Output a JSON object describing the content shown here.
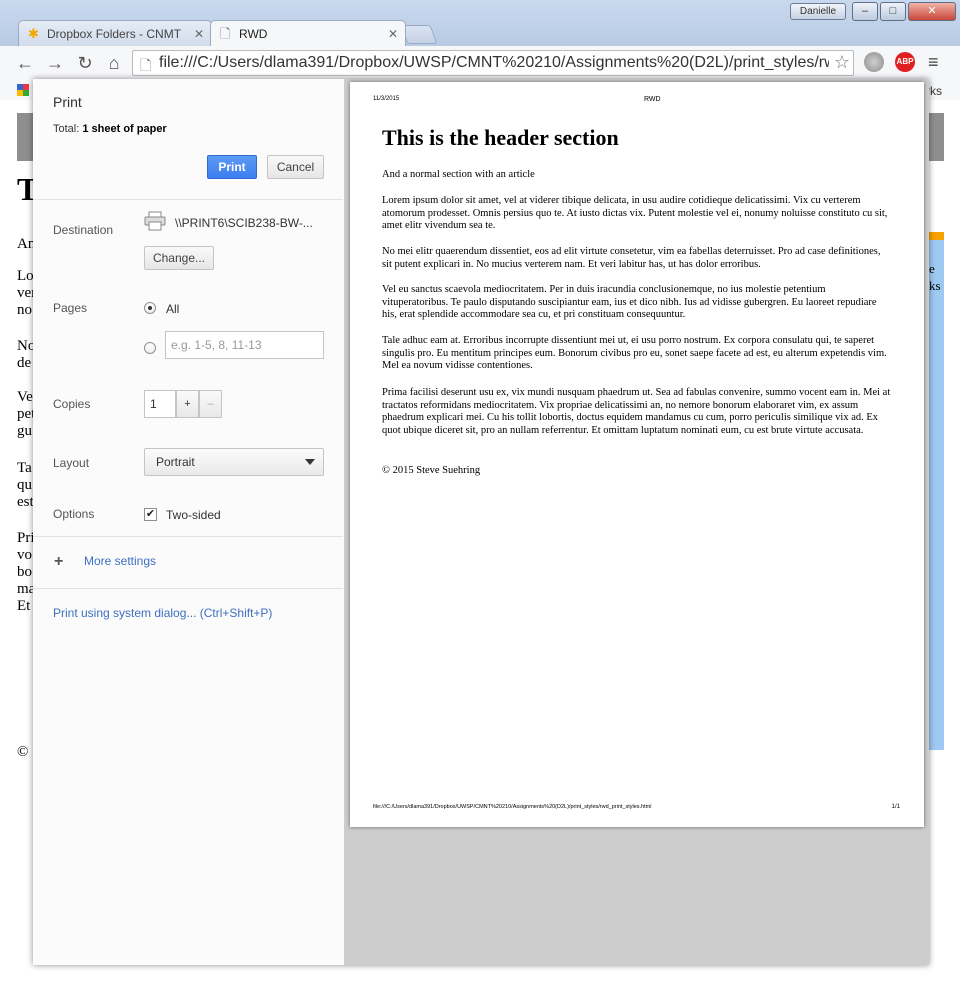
{
  "browser": {
    "user_name": "Danielle",
    "window_controls": {
      "minimize": "‒",
      "maximize": "□",
      "close": "✕"
    },
    "tabs": [
      {
        "title": "Dropbox Folders - CNMT",
        "icon": "dropbox-icon",
        "active": false
      },
      {
        "title": "RWD",
        "icon": "page-icon",
        "active": true
      }
    ],
    "address": "file:///C:/Users/dlama391/Dropbox/UWSP/CMNT%20210/Assignments%20(D2L)/print_styles/rw",
    "bookmarks_bar_right": "rks",
    "extensions": [
      {
        "name": "shield-extension-icon",
        "color": "#8a8a8a"
      },
      {
        "name": "adblock-plus-icon",
        "label": "ABP",
        "color": "#e02020"
      }
    ]
  },
  "background_page": {
    "heading_initial": "T",
    "lines": [
      "An",
      "Lo",
      "ver",
      "no",
      "No",
      "de",
      "Ve",
      "pet",
      "gu",
      "Ta",
      "qu",
      "est",
      "Pri",
      "vo",
      "bo",
      "ma",
      "Et",
      "©"
    ],
    "side_lines": [
      "e",
      "ks"
    ],
    "colors": {
      "header": "#8e8e8e",
      "sidebar": "#9ec9f3",
      "accent": "#f7a200"
    }
  },
  "print_dialog": {
    "title": "Print",
    "total_label": "Total:",
    "total_value": "1 sheet of paper",
    "print_button": "Print",
    "cancel_button": "Cancel",
    "destination": {
      "label": "Destination",
      "printer_name": "\\\\PRINT6\\SCIB238-BW-...",
      "change_button": "Change..."
    },
    "pages": {
      "label": "Pages",
      "all_label": "All",
      "all_selected": true,
      "range_placeholder": "e.g. 1-5, 8, 11-13"
    },
    "copies": {
      "label": "Copies",
      "value": "1",
      "increment": "+",
      "decrement": "–"
    },
    "layout": {
      "label": "Layout",
      "selected": "Portrait"
    },
    "options": {
      "label": "Options",
      "two_sided_label": "Two-sided",
      "two_sided_checked": true
    },
    "more_settings": "More settings",
    "system_dialog_link": "Print using system dialog... (Ctrl+Shift+P)",
    "accent_color": "#3b7ef0"
  },
  "preview": {
    "date": "11/3/2015",
    "page_title": "RWD",
    "header": "This is the header section",
    "paragraphs": [
      "And a normal section with an article",
      "Lorem ipsum dolor sit amet, vel at viderer tibique delicata, in usu audire cotidieque delicatissimi. Vix cu verterem atomorum prodesset. Omnis persius quo te. At iusto dictas vix. Putent molestie vel ei, nonumy noluisse constituto cu sit, amet elitr vivendum sea te.",
      "No mei elitr quaerendum dissentiet, eos ad elit virtute consetetur, vim ea fabellas deterruisset. Pro ad case definitiones, sit putent explicari in. No mucius verterem nam. Et veri labitur has, ut has dolor erroribus.",
      "Vel eu sanctus scaevola mediocritatem. Per in duis iracundia conclusionemque, no ius molestie petentium vituperatoribus. Te paulo disputando suscipiantur eam, ius et dico nibh. Ius ad vidisse gubergren. Eu laoreet repudiare his, erat splendide accommodare sea cu, et pri constituam consequuntur.",
      "Tale adhuc eam at. Erroribus incorrupte dissentiunt mei ut, ei usu porro nostrum. Ex corpora consulatu qui, te saperet singulis pro. Eu mentitum principes eum. Bonorum civibus pro eu, sonet saepe facete ad est, eu alterum expetendis vim. Mel ea novum vidisse contentiones.",
      "Prima facilisi deserunt usu ex, vix mundi nusquam phaedrum ut. Sea ad fabulas convenire, summo vocent eam in. Mei at tractatos reformidans mediocritatem. Vix propriae delicatissimi an, no nemore bonorum elaboraret vim, ex assum phaedrum explicari mei. Cu his tollit lobortis, doctus equidem mandamus cu cum, porro periculis similique vix ad. Ex quot ubique diceret sit, pro an nullam referrentur. Et omittam luptatum nominati eum, cu est brute virtute accusata.",
      "© 2015 Steve Suehring"
    ],
    "footer_url": "file:///C:/Users/dlama391/Dropbox/UWSP/CMNT%20210/Assignments%20(D2L)/print_styles/rwd_print_styles.html",
    "page_number": "1/1"
  }
}
